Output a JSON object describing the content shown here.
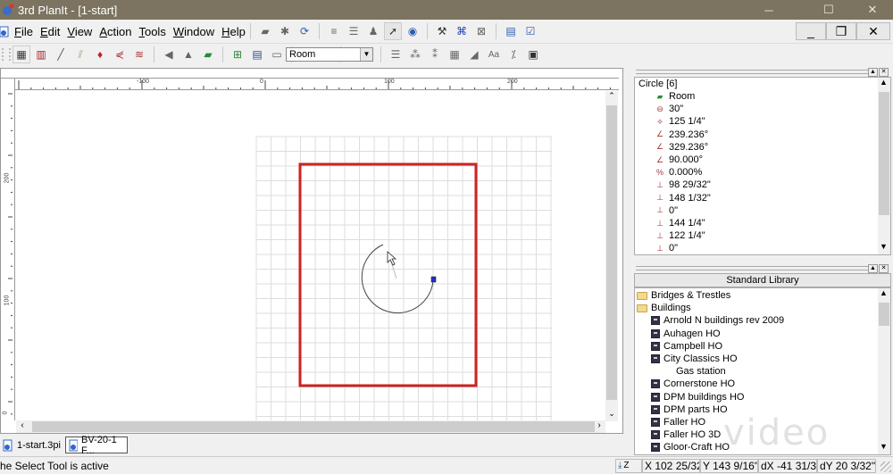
{
  "window": {
    "title": "3rd PlanIt - [1-start]",
    "controls": {
      "minimize": "─",
      "maximize": "☐",
      "close": "✕"
    },
    "mdi_controls": {
      "minimize": "_",
      "restore": "❐",
      "close": "✕"
    }
  },
  "menubar": {
    "items": [
      {
        "label": "File",
        "accel": "F"
      },
      {
        "label": "Edit",
        "accel": "E"
      },
      {
        "label": "View",
        "accel": "V"
      },
      {
        "label": "Action",
        "accel": "A"
      },
      {
        "label": "Tools",
        "accel": "T"
      },
      {
        "label": "Window",
        "accel": "W"
      },
      {
        "label": "Help",
        "accel": "H"
      }
    ]
  },
  "toolbar1": {
    "icons": [
      "flatten-icon",
      "build-icon",
      "refresh-icon",
      "bridge-icon",
      "stack-icon",
      "figure-icon",
      "select-tool-icon",
      "camera-target-icon",
      "tool-plus-icon",
      "zoom-fit-icon",
      "zoom-box-icon",
      "window-icon",
      "check-list-icon"
    ]
  },
  "toolbar2": {
    "icons": [
      "grid-icon",
      "track-icon",
      "line-icon",
      "double-line-icon",
      "pin-icon",
      "turnout-icon",
      "flex-track-icon",
      "benchwork-icon",
      "hill-icon",
      "room-icon",
      "snap-grid-icon",
      "table-icon",
      "picture-icon",
      "arc-icon",
      "disconnect-icon"
    ],
    "layer_combo": {
      "value": "Room"
    },
    "icons_right": [
      "align-icon",
      "group-icon",
      "ungroup-icon",
      "dimension-icon",
      "slope-icon",
      "text-icon",
      "grade-icon",
      "properties-icon"
    ]
  },
  "ruler": {
    "h_labels": [
      "-100",
      "0",
      "100",
      "200"
    ],
    "v_labels": [
      "200",
      "100",
      "0"
    ]
  },
  "document_tabs": [
    {
      "label": "1-start.3pi"
    },
    {
      "label": "BV-20-1 F..."
    }
  ],
  "properties_panel": {
    "header": "Circle [6]",
    "rows": [
      {
        "icon": "layer-icon",
        "value": "Room"
      },
      {
        "icon": "radius-icon",
        "value": "30\""
      },
      {
        "icon": "elevation-icon",
        "value": "125 1/4\""
      },
      {
        "icon": "start-angle-icon",
        "value": "239.236°"
      },
      {
        "icon": "end-angle-icon",
        "value": "329.236°"
      },
      {
        "icon": "sweep-angle-icon",
        "value": "90.000°"
      },
      {
        "icon": "grade-percent-icon",
        "value": "0.000%"
      },
      {
        "icon": "x-start-icon",
        "value": "98 29/32\""
      },
      {
        "icon": "y-start-icon",
        "value": "148 1/32\""
      },
      {
        "icon": "z-start-icon",
        "value": "0\""
      },
      {
        "icon": "x-end-icon",
        "value": "144 1/4\""
      },
      {
        "icon": "y-end-icon",
        "value": "122 1/4\""
      },
      {
        "icon": "z-end-icon",
        "value": "0\""
      }
    ]
  },
  "library_panel": {
    "header": "Standard Library",
    "items": [
      {
        "type": "folder",
        "label": "Bridges & Trestles",
        "level": 0
      },
      {
        "type": "folder",
        "label": "Buildings",
        "level": 0
      },
      {
        "type": "building",
        "label": "Arnold N buildings rev 2009",
        "level": 1
      },
      {
        "type": "building",
        "label": "Auhagen HO",
        "level": 1
      },
      {
        "type": "building",
        "label": "Campbell HO",
        "level": 1
      },
      {
        "type": "building",
        "label": "City Classics HO",
        "level": 1
      },
      {
        "type": "leaf",
        "label": "Gas station",
        "level": 2
      },
      {
        "type": "building",
        "label": "Cornerstone HO",
        "level": 1
      },
      {
        "type": "building",
        "label": "DPM buildings HO",
        "level": 1
      },
      {
        "type": "building",
        "label": "DPM parts HO",
        "level": 1
      },
      {
        "type": "building",
        "label": "Faller HO",
        "level": 1
      },
      {
        "type": "building",
        "label": "Faller HO 3D",
        "level": 1
      },
      {
        "type": "building",
        "label": "Gloor-Craft HO",
        "level": 1
      }
    ]
  },
  "statusbar": {
    "message": "he Select Tool is active",
    "z_label": "Z",
    "x": "X 102 25/32",
    "y": "Y 143 9/16\"",
    "dx": "dX -41 31/3",
    "dy": "dY 20 3/32\""
  },
  "colors": {
    "titlebar": "#7c7460",
    "room_outline": "#cc2222",
    "selection_handle": "#2233cc",
    "grid": "#dddddd"
  },
  "watermark": "video"
}
